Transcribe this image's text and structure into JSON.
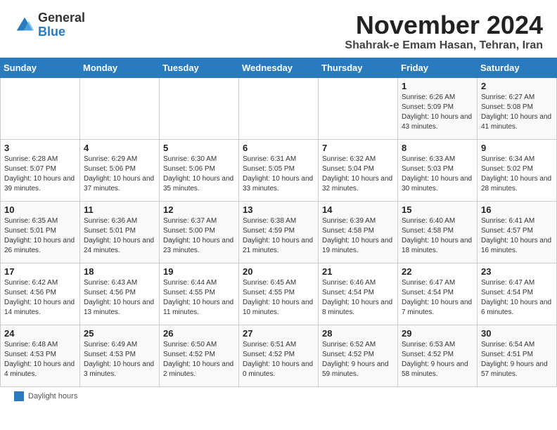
{
  "header": {
    "logo_general": "General",
    "logo_blue": "Blue",
    "month_title": "November 2024",
    "subtitle": "Shahrak-e Emam Hasan, Tehran, Iran"
  },
  "days_of_week": [
    "Sunday",
    "Monday",
    "Tuesday",
    "Wednesday",
    "Thursday",
    "Friday",
    "Saturday"
  ],
  "weeks": [
    [
      {
        "day": "",
        "info": ""
      },
      {
        "day": "",
        "info": ""
      },
      {
        "day": "",
        "info": ""
      },
      {
        "day": "",
        "info": ""
      },
      {
        "day": "",
        "info": ""
      },
      {
        "day": "1",
        "info": "Sunrise: 6:26 AM\nSunset: 5:09 PM\nDaylight: 10 hours and 43 minutes."
      },
      {
        "day": "2",
        "info": "Sunrise: 6:27 AM\nSunset: 5:08 PM\nDaylight: 10 hours and 41 minutes."
      }
    ],
    [
      {
        "day": "3",
        "info": "Sunrise: 6:28 AM\nSunset: 5:07 PM\nDaylight: 10 hours and 39 minutes."
      },
      {
        "day": "4",
        "info": "Sunrise: 6:29 AM\nSunset: 5:06 PM\nDaylight: 10 hours and 37 minutes."
      },
      {
        "day": "5",
        "info": "Sunrise: 6:30 AM\nSunset: 5:06 PM\nDaylight: 10 hours and 35 minutes."
      },
      {
        "day": "6",
        "info": "Sunrise: 6:31 AM\nSunset: 5:05 PM\nDaylight: 10 hours and 33 minutes."
      },
      {
        "day": "7",
        "info": "Sunrise: 6:32 AM\nSunset: 5:04 PM\nDaylight: 10 hours and 32 minutes."
      },
      {
        "day": "8",
        "info": "Sunrise: 6:33 AM\nSunset: 5:03 PM\nDaylight: 10 hours and 30 minutes."
      },
      {
        "day": "9",
        "info": "Sunrise: 6:34 AM\nSunset: 5:02 PM\nDaylight: 10 hours and 28 minutes."
      }
    ],
    [
      {
        "day": "10",
        "info": "Sunrise: 6:35 AM\nSunset: 5:01 PM\nDaylight: 10 hours and 26 minutes."
      },
      {
        "day": "11",
        "info": "Sunrise: 6:36 AM\nSunset: 5:01 PM\nDaylight: 10 hours and 24 minutes."
      },
      {
        "day": "12",
        "info": "Sunrise: 6:37 AM\nSunset: 5:00 PM\nDaylight: 10 hours and 23 minutes."
      },
      {
        "day": "13",
        "info": "Sunrise: 6:38 AM\nSunset: 4:59 PM\nDaylight: 10 hours and 21 minutes."
      },
      {
        "day": "14",
        "info": "Sunrise: 6:39 AM\nSunset: 4:58 PM\nDaylight: 10 hours and 19 minutes."
      },
      {
        "day": "15",
        "info": "Sunrise: 6:40 AM\nSunset: 4:58 PM\nDaylight: 10 hours and 18 minutes."
      },
      {
        "day": "16",
        "info": "Sunrise: 6:41 AM\nSunset: 4:57 PM\nDaylight: 10 hours and 16 minutes."
      }
    ],
    [
      {
        "day": "17",
        "info": "Sunrise: 6:42 AM\nSunset: 4:56 PM\nDaylight: 10 hours and 14 minutes."
      },
      {
        "day": "18",
        "info": "Sunrise: 6:43 AM\nSunset: 4:56 PM\nDaylight: 10 hours and 13 minutes."
      },
      {
        "day": "19",
        "info": "Sunrise: 6:44 AM\nSunset: 4:55 PM\nDaylight: 10 hours and 11 minutes."
      },
      {
        "day": "20",
        "info": "Sunrise: 6:45 AM\nSunset: 4:55 PM\nDaylight: 10 hours and 10 minutes."
      },
      {
        "day": "21",
        "info": "Sunrise: 6:46 AM\nSunset: 4:54 PM\nDaylight: 10 hours and 8 minutes."
      },
      {
        "day": "22",
        "info": "Sunrise: 6:47 AM\nSunset: 4:54 PM\nDaylight: 10 hours and 7 minutes."
      },
      {
        "day": "23",
        "info": "Sunrise: 6:47 AM\nSunset: 4:54 PM\nDaylight: 10 hours and 6 minutes."
      }
    ],
    [
      {
        "day": "24",
        "info": "Sunrise: 6:48 AM\nSunset: 4:53 PM\nDaylight: 10 hours and 4 minutes."
      },
      {
        "day": "25",
        "info": "Sunrise: 6:49 AM\nSunset: 4:53 PM\nDaylight: 10 hours and 3 minutes."
      },
      {
        "day": "26",
        "info": "Sunrise: 6:50 AM\nSunset: 4:52 PM\nDaylight: 10 hours and 2 minutes."
      },
      {
        "day": "27",
        "info": "Sunrise: 6:51 AM\nSunset: 4:52 PM\nDaylight: 10 hours and 0 minutes."
      },
      {
        "day": "28",
        "info": "Sunrise: 6:52 AM\nSunset: 4:52 PM\nDaylight: 9 hours and 59 minutes."
      },
      {
        "day": "29",
        "info": "Sunrise: 6:53 AM\nSunset: 4:52 PM\nDaylight: 9 hours and 58 minutes."
      },
      {
        "day": "30",
        "info": "Sunrise: 6:54 AM\nSunset: 4:51 PM\nDaylight: 9 hours and 57 minutes."
      }
    ]
  ],
  "footer": {
    "legend_label": "Daylight hours"
  }
}
